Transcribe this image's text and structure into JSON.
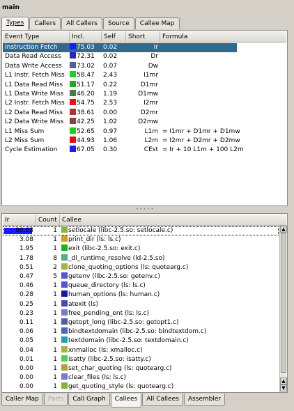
{
  "window": {
    "title": "main"
  },
  "top_tabs": [
    {
      "label": "Types",
      "active": true
    },
    {
      "label": "Callers"
    },
    {
      "label": "All Callers"
    },
    {
      "label": "Source"
    },
    {
      "label": "Callee Map"
    }
  ],
  "event_table": {
    "headers": [
      "Event Type",
      "Incl.",
      "Self",
      "Short",
      "Formula"
    ],
    "rows": [
      {
        "name": "Instruction Fetch",
        "color": "#1a1aff",
        "incl": "75.03",
        "self": "0.02",
        "short": "Ir",
        "formula": "",
        "selected": true
      },
      {
        "name": "Data Read Access",
        "color": "#2828b4",
        "incl": "72.31",
        "self": "0.02",
        "short": "Dr",
        "formula": ""
      },
      {
        "name": "Data Write Access",
        "color": "#5a5a96",
        "incl": "73.02",
        "self": "0.07",
        "short": "Dw",
        "formula": ""
      },
      {
        "name": "L1 Instr. Fetch Miss",
        "color": "#22cc22",
        "incl": "58.47",
        "self": "2.43",
        "short": "I1mr",
        "formula": ""
      },
      {
        "name": "L1 Data Read Miss",
        "color": "#22aa22",
        "incl": "51.17",
        "self": "0.22",
        "short": "D1mr",
        "formula": ""
      },
      {
        "name": "L1 Data Write Miss",
        "color": "#4a7a4a",
        "incl": "46.20",
        "self": "1.19",
        "short": "D1mw",
        "formula": ""
      },
      {
        "name": "L2 Instr. Fetch Miss",
        "color": "#ee1111",
        "incl": "54.75",
        "self": "2.53",
        "short": "I2mr",
        "formula": ""
      },
      {
        "name": "L2 Data Read Miss",
        "color": "#aa3333",
        "incl": "38.61",
        "self": "0.00",
        "short": "D2mr",
        "formula": ""
      },
      {
        "name": "L2 Data Write Miss",
        "color": "#7a4a4a",
        "incl": "42.25",
        "self": "1.02",
        "short": "D2mw",
        "formula": ""
      },
      {
        "name": "L1 Miss Sum",
        "color": "#22cc22",
        "incl": "52.65",
        "self": "0.97",
        "short": "L1m",
        "formula": "= I1mr + D1mr + D1mw"
      },
      {
        "name": "L2 Miss Sum",
        "color": "#dd1111",
        "incl": "44.93",
        "self": "1.06",
        "short": "L2m",
        "formula": "= I2mr + D2mr + D2mw"
      },
      {
        "name": "Cycle Estimation",
        "color": "#1a1aff",
        "incl": "67.05",
        "self": "0.30",
        "short": "CEst",
        "formula": "= Ir + 10 L1m + 100 L2m"
      }
    ]
  },
  "callee_table": {
    "headers": [
      "Ir",
      "Count",
      "Callee"
    ],
    "rows": [
      {
        "ir": "90.68",
        "bar": 0.9068,
        "count": "1",
        "color": "#8ab04a",
        "callee": "setlocale (libc-2.5.so: setlocale.c)"
      },
      {
        "ir": "3.08",
        "count": "1",
        "color": "#d4a017",
        "callee": "print_dir (ls: ls.c)"
      },
      {
        "ir": "1.95",
        "count": "1",
        "color": "#22b022",
        "callee": "exit (libc-2.5.so: exit.c)"
      },
      {
        "ir": "1.78",
        "count": "8",
        "color": "#55aa88",
        "callee": "_dl_runtime_resolve (ld-2.5.so)"
      },
      {
        "ir": "0.51",
        "count": "2",
        "color": "#aab040",
        "callee": "clone_quoting_options (ls: quotearg.c)"
      },
      {
        "ir": "0.47",
        "count": "5",
        "color": "#5555cc",
        "callee": "getenv (libc-2.5.so: getenv.c)"
      },
      {
        "ir": "0.46",
        "count": "1",
        "color": "#5555cc",
        "callee": "queue_directory (ls: ls.c)"
      },
      {
        "ir": "0.28",
        "count": "1",
        "color": "#1a1a99",
        "callee": "human_options (ls: human.c)"
      },
      {
        "ir": "0.25",
        "count": "1",
        "color": "#4a4ab0",
        "callee": "atexit (ls)"
      },
      {
        "ir": "0.23",
        "count": "1",
        "color": "#7a7acc",
        "callee": "free_pending_ent (ls: ls.c)"
      },
      {
        "ir": "0.11",
        "count": "1",
        "color": "#5a5aa0",
        "callee": "getopt_long (libc-2.5.so: getopt1.c)"
      },
      {
        "ir": "0.06",
        "count": "1",
        "color": "#4a6ab0",
        "callee": "bindtextdomain (libc-2.5.so: bindtextdom.c)"
      },
      {
        "ir": "0.05",
        "count": "1",
        "color": "#22a0b0",
        "callee": "textdomain (libc-2.5.so: textdomain.c)"
      },
      {
        "ir": "0.04",
        "count": "1",
        "color": "#b0b040",
        "callee": "xnmalloc (ls: xmalloc.c)"
      },
      {
        "ir": "0.01",
        "count": "1",
        "color": "#55cc55",
        "callee": "isatty (libc-2.5.so: isatty.c)"
      },
      {
        "ir": "0.00",
        "count": "1",
        "color": "#b0a040",
        "callee": "set_char_quoting (ls: quotearg.c)"
      },
      {
        "ir": "0.00",
        "count": "1",
        "color": "#7a7acc",
        "callee": "clear_files (ls: ls.c)"
      },
      {
        "ir": "0.00",
        "count": "1",
        "color": "#88b040",
        "callee": "get_quoting_style (ls: quotearg.c)"
      }
    ]
  },
  "bottom_tabs": [
    {
      "label": "Caller Map"
    },
    {
      "label": "Parts",
      "disabled": true
    },
    {
      "label": "Call Graph"
    },
    {
      "label": "Callees",
      "active": true
    },
    {
      "label": "All Callees"
    },
    {
      "label": "Assembler"
    }
  ]
}
